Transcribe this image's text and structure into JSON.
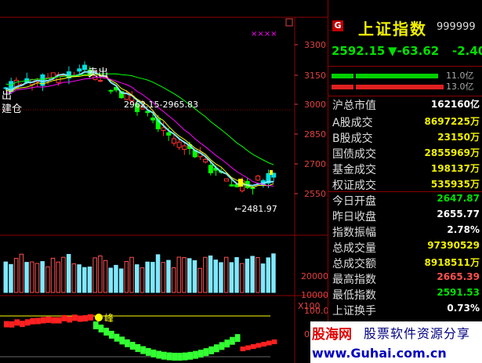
{
  "chart": {
    "y_ticks": [
      "3300",
      "3150",
      "3000",
      "2850",
      "2700",
      "2550"
    ],
    "vol_ticks": [
      "20000",
      "10000"
    ],
    "vol_unit": "X100",
    "ind_ticks": [
      "100.0",
      "0.0"
    ],
    "markers": {
      "xxxx": "××××",
      "sell": "卖出",
      "buy_left": "建仓",
      "buy_top": "出",
      "peak": "峰"
    },
    "annotations": {
      "range": "2962.15-2965.83",
      "low": "←2481.97"
    },
    "colors": {
      "up": "#ff3030",
      "down": "#00e0e0",
      "ma": [
        "#ffffff",
        "#ffff00",
        "#ff00ff",
        "#00ff00"
      ]
    }
  },
  "panel": {
    "badge": "G",
    "name": "上证指数",
    "code": "999999",
    "price": "2592.15",
    "change": "▼-63.62",
    "pct": "-2.40",
    "bar1_label": "11.0亿",
    "bar2_label": "13.0亿",
    "rows": [
      {
        "k": "沪总市值",
        "v": "162160亿",
        "c": "#ffffff"
      },
      {
        "k": "A股成交",
        "v": "8697225万",
        "c": "#f0f000"
      },
      {
        "k": "B股成交",
        "v": "23150万",
        "c": "#f0f000"
      },
      {
        "k": "国债成交",
        "v": "2855969万",
        "c": "#f0f000"
      },
      {
        "k": "基金成交",
        "v": "198137万",
        "c": "#f0f000"
      },
      {
        "k": "权证成交",
        "v": "535935万",
        "c": "#f0f000"
      },
      {
        "k": "今日开盘",
        "v": "2647.87",
        "c": "#00e000"
      },
      {
        "k": "昨日收盘",
        "v": "2655.77",
        "c": "#ffffff"
      },
      {
        "k": "指数振幅",
        "v": "2.78%",
        "c": "#ffffff"
      },
      {
        "k": "总成交量",
        "v": "97390529",
        "c": "#f0f000"
      },
      {
        "k": "总成交额",
        "v": "8918511万",
        "c": "#f0f000"
      },
      {
        "k": "最高指数",
        "v": "2665.39",
        "c": "#ff5050"
      },
      {
        "k": "最低指数",
        "v": "2591.53",
        "c": "#00e000"
      },
      {
        "k": "上证换手",
        "v": "0.73%",
        "c": "#ffffff"
      }
    ]
  },
  "watermark": {
    "brand": "股海网",
    "slogan": "股票软件资源分享",
    "url": "www.Guhai.com.cn"
  }
}
